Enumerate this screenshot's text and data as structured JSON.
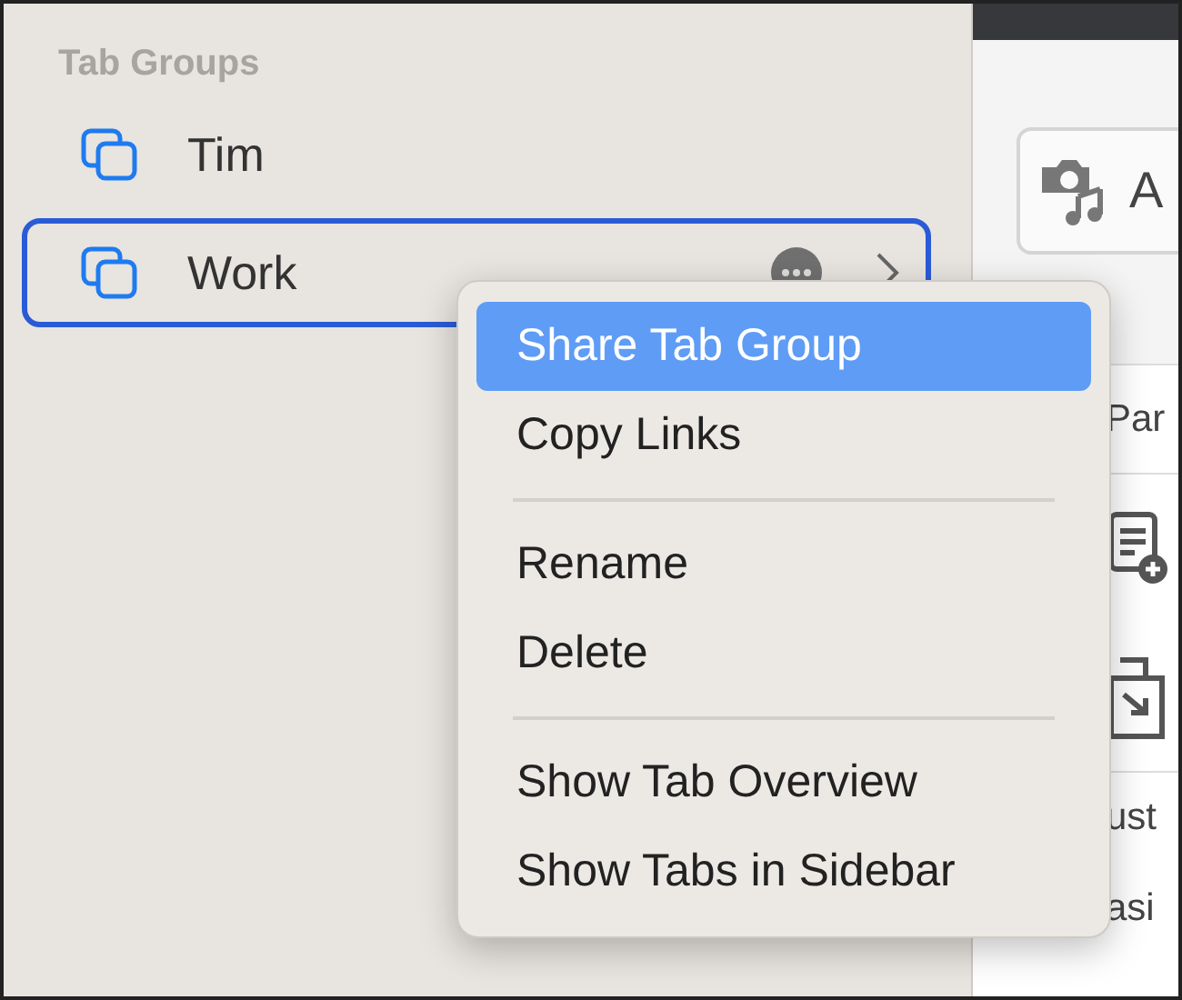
{
  "sidebar": {
    "header": "Tab Groups",
    "items": [
      {
        "label": "Tim",
        "selected": false
      },
      {
        "label": "Work",
        "selected": true
      }
    ]
  },
  "context_menu": {
    "items": [
      {
        "kind": "item",
        "label": "Share Tab Group",
        "selected": true
      },
      {
        "kind": "item",
        "label": "Copy Links",
        "selected": false
      },
      {
        "kind": "separator"
      },
      {
        "kind": "item",
        "label": "Rename",
        "selected": false
      },
      {
        "kind": "item",
        "label": "Delete",
        "selected": false
      },
      {
        "kind": "separator"
      },
      {
        "kind": "item",
        "label": "Show Tab Overview",
        "selected": false
      },
      {
        "kind": "item",
        "label": "Show Tabs in Sidebar",
        "selected": false
      }
    ]
  },
  "content": {
    "toolbar_button": "A",
    "rows": [
      {
        "kind": "text",
        "text": "Par"
      },
      {
        "kind": "icon"
      },
      {
        "kind": "icon"
      },
      {
        "kind": "text",
        "text": "ust"
      },
      {
        "kind": "text",
        "text": "asi"
      }
    ]
  }
}
